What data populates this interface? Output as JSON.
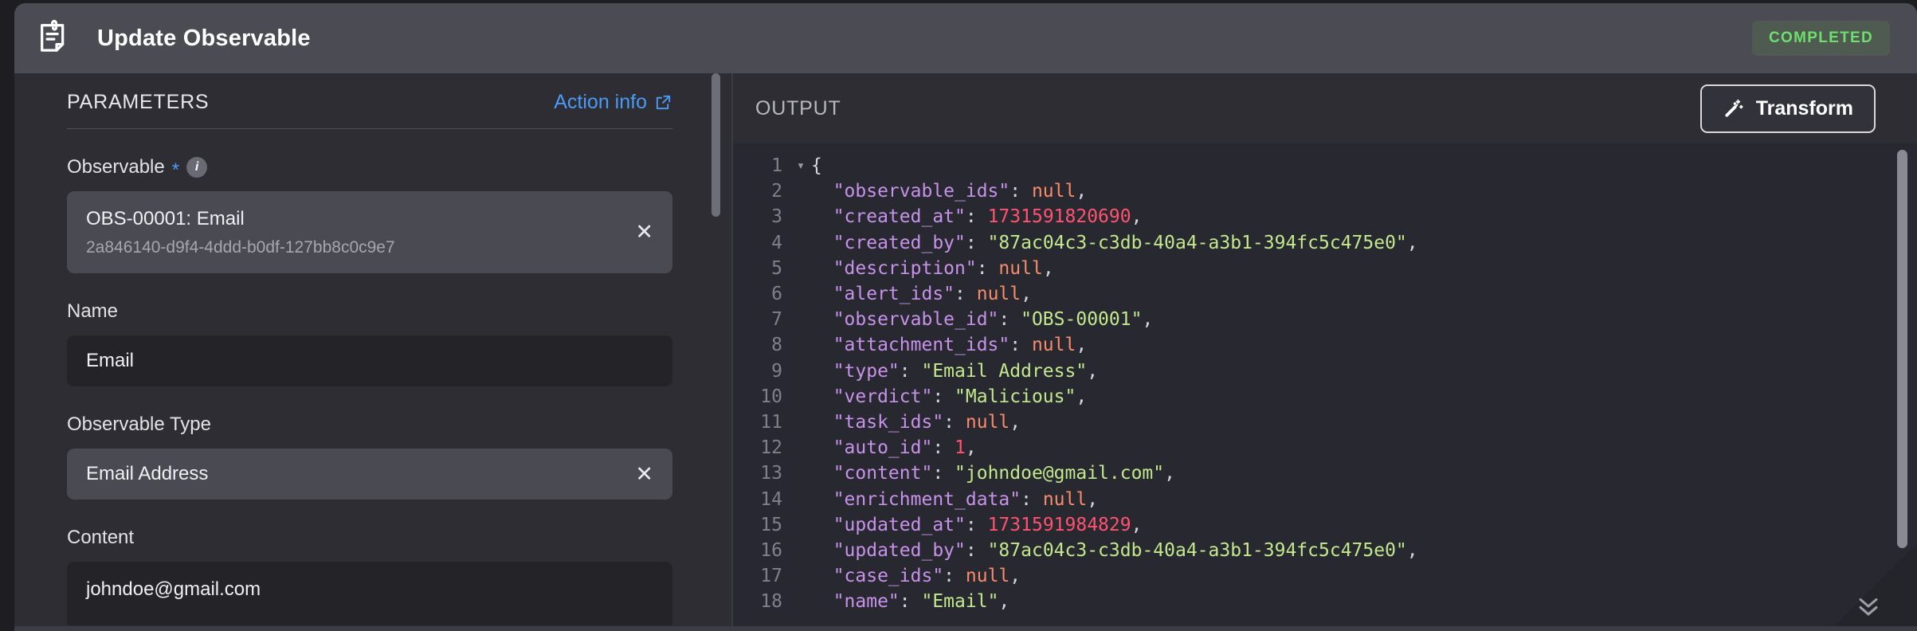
{
  "header": {
    "icon": "note-document-icon",
    "title": "Update Observable",
    "status": "COMPLETED",
    "status_color": "#6ddf6d",
    "status_bg": "#4f5a51"
  },
  "left_panel": {
    "section_title": "PARAMETERS",
    "action_info_label": "Action info",
    "action_info_icon": "external-link-icon",
    "fields": [
      {
        "label": "Observable",
        "required": true,
        "required_marker": "*",
        "info_icon": "info-icon",
        "info_glyph": "i",
        "value_main": "OBS-00001: Email",
        "value_sub": "2a846140-d9f4-4ddd-b0df-127bb8c0c9e7",
        "clear_icon": "close-icon",
        "clear_glyph": "✕",
        "style": "chip"
      },
      {
        "label": "Name",
        "required": false,
        "value_main": "Email",
        "style": "text"
      },
      {
        "label": "Observable Type",
        "required": false,
        "value_main": "Email Address",
        "clear_icon": "close-icon",
        "clear_glyph": "✕",
        "style": "select"
      },
      {
        "label": "Content",
        "required": false,
        "value_main": "johndoe@gmail.com",
        "style": "text"
      }
    ]
  },
  "right_panel": {
    "section_title": "OUTPUT",
    "transform_label": "Transform",
    "transform_icon": "magic-wand-icon",
    "scroll_bottom_icon": "chevron-double-down-icon",
    "code": {
      "language": "json",
      "fold_marker": "▾",
      "colors": {
        "key": "#c792ea",
        "string": "#c3e88d",
        "number": "#ff5370",
        "null": "#f78c6c",
        "punctuation": "#d6d6de",
        "line_number": "#80808c",
        "background": "#282830"
      },
      "lines": [
        {
          "n": "1",
          "fold": true,
          "tokens": [
            {
              "t": "{",
              "c": "pun"
            }
          ]
        },
        {
          "n": "2",
          "fold": false,
          "tokens": [
            {
              "t": "  \"observable_ids\"",
              "c": "key"
            },
            {
              "t": ": ",
              "c": "pun"
            },
            {
              "t": "null",
              "c": "null"
            },
            {
              "t": ",",
              "c": "pun"
            }
          ]
        },
        {
          "n": "3",
          "fold": false,
          "tokens": [
            {
              "t": "  \"created_at\"",
              "c": "key"
            },
            {
              "t": ": ",
              "c": "pun"
            },
            {
              "t": "1731591820690",
              "c": "num"
            },
            {
              "t": ",",
              "c": "pun"
            }
          ]
        },
        {
          "n": "4",
          "fold": false,
          "tokens": [
            {
              "t": "  \"created_by\"",
              "c": "key"
            },
            {
              "t": ": ",
              "c": "pun"
            },
            {
              "t": "\"87ac04c3-c3db-40a4-a3b1-394fc5c475e0\"",
              "c": "str"
            },
            {
              "t": ",",
              "c": "pun"
            }
          ]
        },
        {
          "n": "5",
          "fold": false,
          "tokens": [
            {
              "t": "  \"description\"",
              "c": "key"
            },
            {
              "t": ": ",
              "c": "pun"
            },
            {
              "t": "null",
              "c": "null"
            },
            {
              "t": ",",
              "c": "pun"
            }
          ]
        },
        {
          "n": "6",
          "fold": false,
          "tokens": [
            {
              "t": "  \"alert_ids\"",
              "c": "key"
            },
            {
              "t": ": ",
              "c": "pun"
            },
            {
              "t": "null",
              "c": "null"
            },
            {
              "t": ",",
              "c": "pun"
            }
          ]
        },
        {
          "n": "7",
          "fold": false,
          "tokens": [
            {
              "t": "  \"observable_id\"",
              "c": "key"
            },
            {
              "t": ": ",
              "c": "pun"
            },
            {
              "t": "\"OBS-00001\"",
              "c": "str"
            },
            {
              "t": ",",
              "c": "pun"
            }
          ]
        },
        {
          "n": "8",
          "fold": false,
          "tokens": [
            {
              "t": "  \"attachment_ids\"",
              "c": "key"
            },
            {
              "t": ": ",
              "c": "pun"
            },
            {
              "t": "null",
              "c": "null"
            },
            {
              "t": ",",
              "c": "pun"
            }
          ]
        },
        {
          "n": "9",
          "fold": false,
          "tokens": [
            {
              "t": "  \"type\"",
              "c": "key"
            },
            {
              "t": ": ",
              "c": "pun"
            },
            {
              "t": "\"Email Address\"",
              "c": "str"
            },
            {
              "t": ",",
              "c": "pun"
            }
          ]
        },
        {
          "n": "10",
          "fold": false,
          "tokens": [
            {
              "t": "  \"verdict\"",
              "c": "key"
            },
            {
              "t": ": ",
              "c": "pun"
            },
            {
              "t": "\"Malicious\"",
              "c": "str"
            },
            {
              "t": ",",
              "c": "pun"
            }
          ]
        },
        {
          "n": "11",
          "fold": false,
          "tokens": [
            {
              "t": "  \"task_ids\"",
              "c": "key"
            },
            {
              "t": ": ",
              "c": "pun"
            },
            {
              "t": "null",
              "c": "null"
            },
            {
              "t": ",",
              "c": "pun"
            }
          ]
        },
        {
          "n": "12",
          "fold": false,
          "tokens": [
            {
              "t": "  \"auto_id\"",
              "c": "key"
            },
            {
              "t": ": ",
              "c": "pun"
            },
            {
              "t": "1",
              "c": "num"
            },
            {
              "t": ",",
              "c": "pun"
            }
          ]
        },
        {
          "n": "13",
          "fold": false,
          "tokens": [
            {
              "t": "  \"content\"",
              "c": "key"
            },
            {
              "t": ": ",
              "c": "pun"
            },
            {
              "t": "\"johndoe@gmail.com\"",
              "c": "str"
            },
            {
              "t": ",",
              "c": "pun"
            }
          ]
        },
        {
          "n": "14",
          "fold": false,
          "tokens": [
            {
              "t": "  \"enrichment_data\"",
              "c": "key"
            },
            {
              "t": ": ",
              "c": "pun"
            },
            {
              "t": "null",
              "c": "null"
            },
            {
              "t": ",",
              "c": "pun"
            }
          ]
        },
        {
          "n": "15",
          "fold": false,
          "tokens": [
            {
              "t": "  \"updated_at\"",
              "c": "key"
            },
            {
              "t": ": ",
              "c": "pun"
            },
            {
              "t": "1731591984829",
              "c": "num"
            },
            {
              "t": ",",
              "c": "pun"
            }
          ]
        },
        {
          "n": "16",
          "fold": false,
          "tokens": [
            {
              "t": "  \"updated_by\"",
              "c": "key"
            },
            {
              "t": ": ",
              "c": "pun"
            },
            {
              "t": "\"87ac04c3-c3db-40a4-a3b1-394fc5c475e0\"",
              "c": "str"
            },
            {
              "t": ",",
              "c": "pun"
            }
          ]
        },
        {
          "n": "17",
          "fold": false,
          "tokens": [
            {
              "t": "  \"case_ids\"",
              "c": "key"
            },
            {
              "t": ": ",
              "c": "pun"
            },
            {
              "t": "null",
              "c": "null"
            },
            {
              "t": ",",
              "c": "pun"
            }
          ]
        },
        {
          "n": "18",
          "fold": false,
          "tokens": [
            {
              "t": "  \"name\"",
              "c": "key"
            },
            {
              "t": ": ",
              "c": "pun"
            },
            {
              "t": "\"Email\"",
              "c": "str"
            },
            {
              "t": ",",
              "c": "pun"
            }
          ]
        }
      ]
    }
  }
}
